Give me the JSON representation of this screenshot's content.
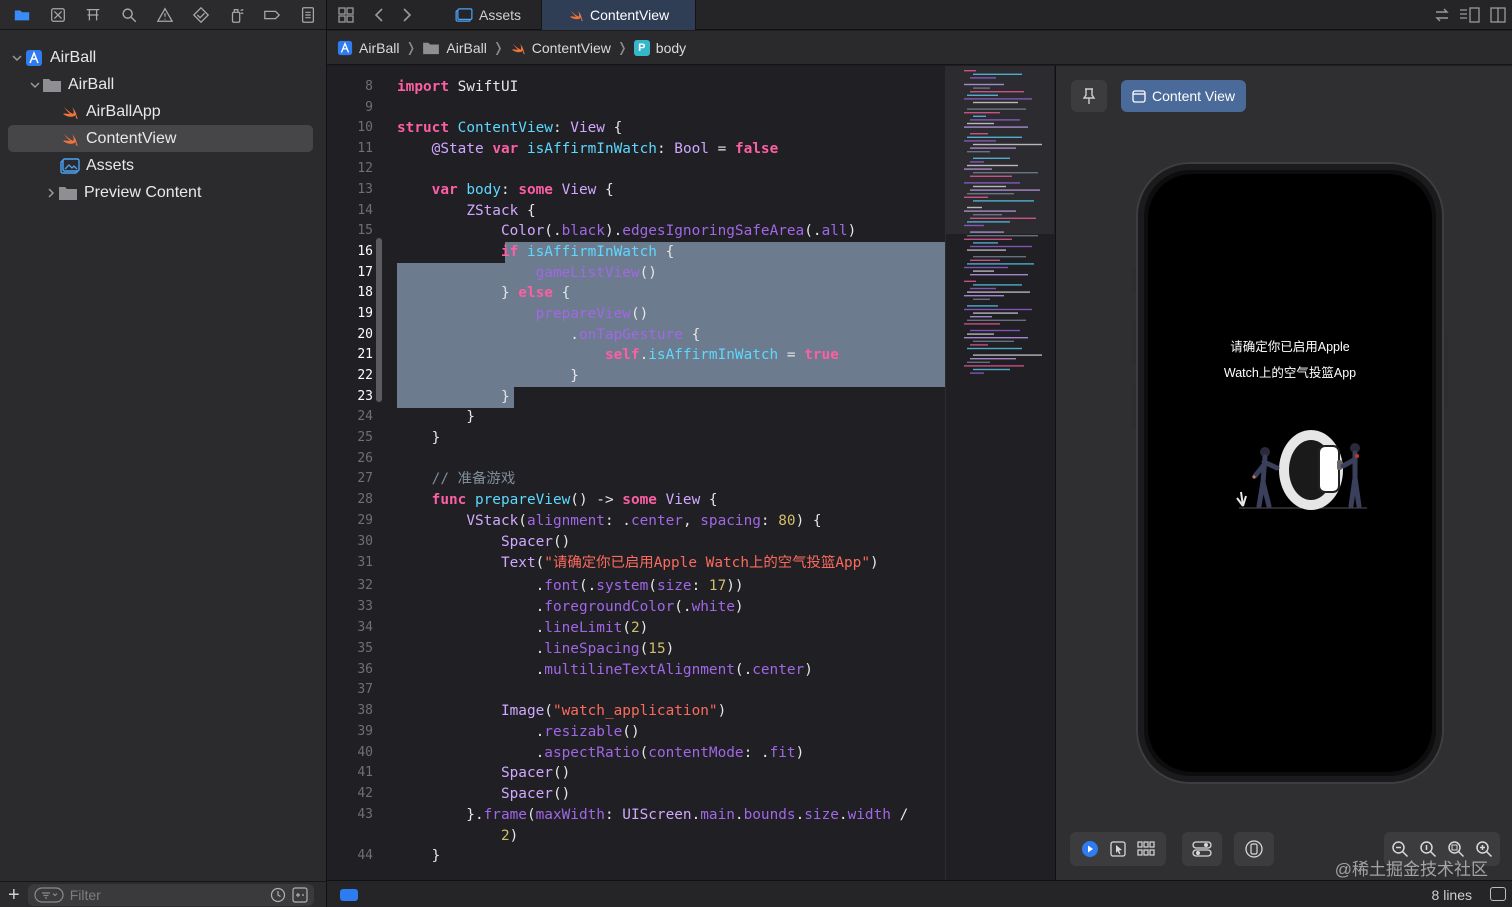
{
  "navigator": {
    "tree": [
      {
        "label": "AirBall",
        "icon": "project-icon"
      },
      {
        "label": "AirBall",
        "icon": "folder-icon"
      },
      {
        "label": "AirBallApp",
        "icon": "swift-icon"
      },
      {
        "label": "ContentView",
        "icon": "swift-icon"
      },
      {
        "label": "Assets",
        "icon": "assets-icon"
      },
      {
        "label": "Preview Content",
        "icon": "folder-icon"
      }
    ],
    "filter_placeholder": "Filter"
  },
  "tabs": [
    {
      "label": "Assets"
    },
    {
      "label": "ContentView"
    }
  ],
  "breadcrumb": [
    "AirBall",
    "AirBall",
    "ContentView",
    "body"
  ],
  "breadcrumb_badge": "P",
  "editor": {
    "first_line": 8,
    "highlight_start": 16,
    "highlight_end": 23
  },
  "canvas": {
    "chip_label": "Content View",
    "preview_text_line1": "请确定你已启用Apple",
    "preview_text_line2": "Watch上的空气投篮App",
    "watermark": "@稀土掘金技术社区"
  },
  "status": {
    "line_count": "8 lines"
  },
  "colors": {
    "accent": "#3a8bf7",
    "selection": "#6d7b8e",
    "active_tab": "#2f3e55",
    "chip": "#4a6a99"
  }
}
